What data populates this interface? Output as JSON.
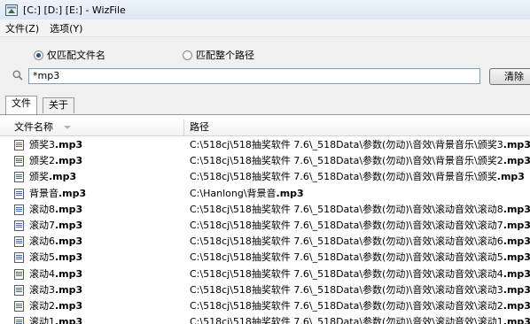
{
  "window": {
    "title": "[C:] [D:] [E:] - WizFile"
  },
  "menu": [
    "文件(Z)",
    "选项(Y)"
  ],
  "options": {
    "match_filename_label": "仅匹配文件名",
    "match_fullpath_label": "匹配整个路径",
    "selected": "match_filename"
  },
  "search": {
    "value": "*mp3",
    "clear_label": "清除"
  },
  "tabs": [
    {
      "label": "文件",
      "active": true
    },
    {
      "label": "关于",
      "active": false
    }
  ],
  "columns": {
    "name": "文件名称",
    "path": "路径"
  },
  "files": [
    {
      "stem": "颁奖3",
      "ext": ".mp3",
      "dir": "C:\\518cj\\518抽奖软件 7.6\\_518Data\\参数(勿动)\\音效\\背景音乐\\颁奖3",
      "dir_ext": ".mp3"
    },
    {
      "stem": "颁奖2",
      "ext": ".mp3",
      "dir": "C:\\518cj\\518抽奖软件 7.6\\_518Data\\参数(勿动)\\音效\\背景音乐\\颁奖2",
      "dir_ext": ".mp3"
    },
    {
      "stem": "颁奖",
      "ext": ".mp3",
      "dir": "C:\\518cj\\518抽奖软件 7.6\\_518Data\\参数(勿动)\\音效\\背景音乐\\颁奖",
      "dir_ext": ".mp3"
    },
    {
      "stem": "背景音",
      "ext": ".mp3",
      "dir": "C:\\Hanlong\\背景音",
      "dir_ext": ".mp3"
    },
    {
      "stem": "滚动8",
      "ext": ".mp3",
      "dir": "C:\\518cj\\518抽奖软件 7.6\\_518Data\\参数(勿动)\\音效\\滚动音效\\滚动8",
      "dir_ext": ".mp3"
    },
    {
      "stem": "滚动7",
      "ext": ".mp3",
      "dir": "C:\\518cj\\518抽奖软件 7.6\\_518Data\\参数(勿动)\\音效\\滚动音效\\滚动7",
      "dir_ext": ".mp3"
    },
    {
      "stem": "滚动6",
      "ext": ".mp3",
      "dir": "C:\\518cj\\518抽奖软件 7.6\\_518Data\\参数(勿动)\\音效\\滚动音效\\滚动6",
      "dir_ext": ".mp3"
    },
    {
      "stem": "滚动5",
      "ext": ".mp3",
      "dir": "C:\\518cj\\518抽奖软件 7.6\\_518Data\\参数(勿动)\\音效\\滚动音效\\滚动5",
      "dir_ext": ".mp3"
    },
    {
      "stem": "滚动4",
      "ext": ".mp3",
      "dir": "C:\\518cj\\518抽奖软件 7.6\\_518Data\\参数(勿动)\\音效\\滚动音效\\滚动4",
      "dir_ext": ".mp3"
    },
    {
      "stem": "滚动3",
      "ext": ".mp3",
      "dir": "C:\\518cj\\518抽奖软件 7.6\\_518Data\\参数(勿动)\\音效\\滚动音效\\滚动3",
      "dir_ext": ".mp3"
    },
    {
      "stem": "滚动2",
      "ext": ".mp3",
      "dir": "C:\\518cj\\518抽奖软件 7.6\\_518Data\\参数(勿动)\\音效\\滚动音效\\滚动2",
      "dir_ext": ".mp3"
    },
    {
      "stem": "滚动1",
      "ext": ".mp3",
      "dir": "C:\\518cj\\518抽奖软件 7.6\\_518Data\\参数(勿动)\\音效\\滚动音效\\滚动1",
      "dir_ext": ".mp3"
    }
  ]
}
